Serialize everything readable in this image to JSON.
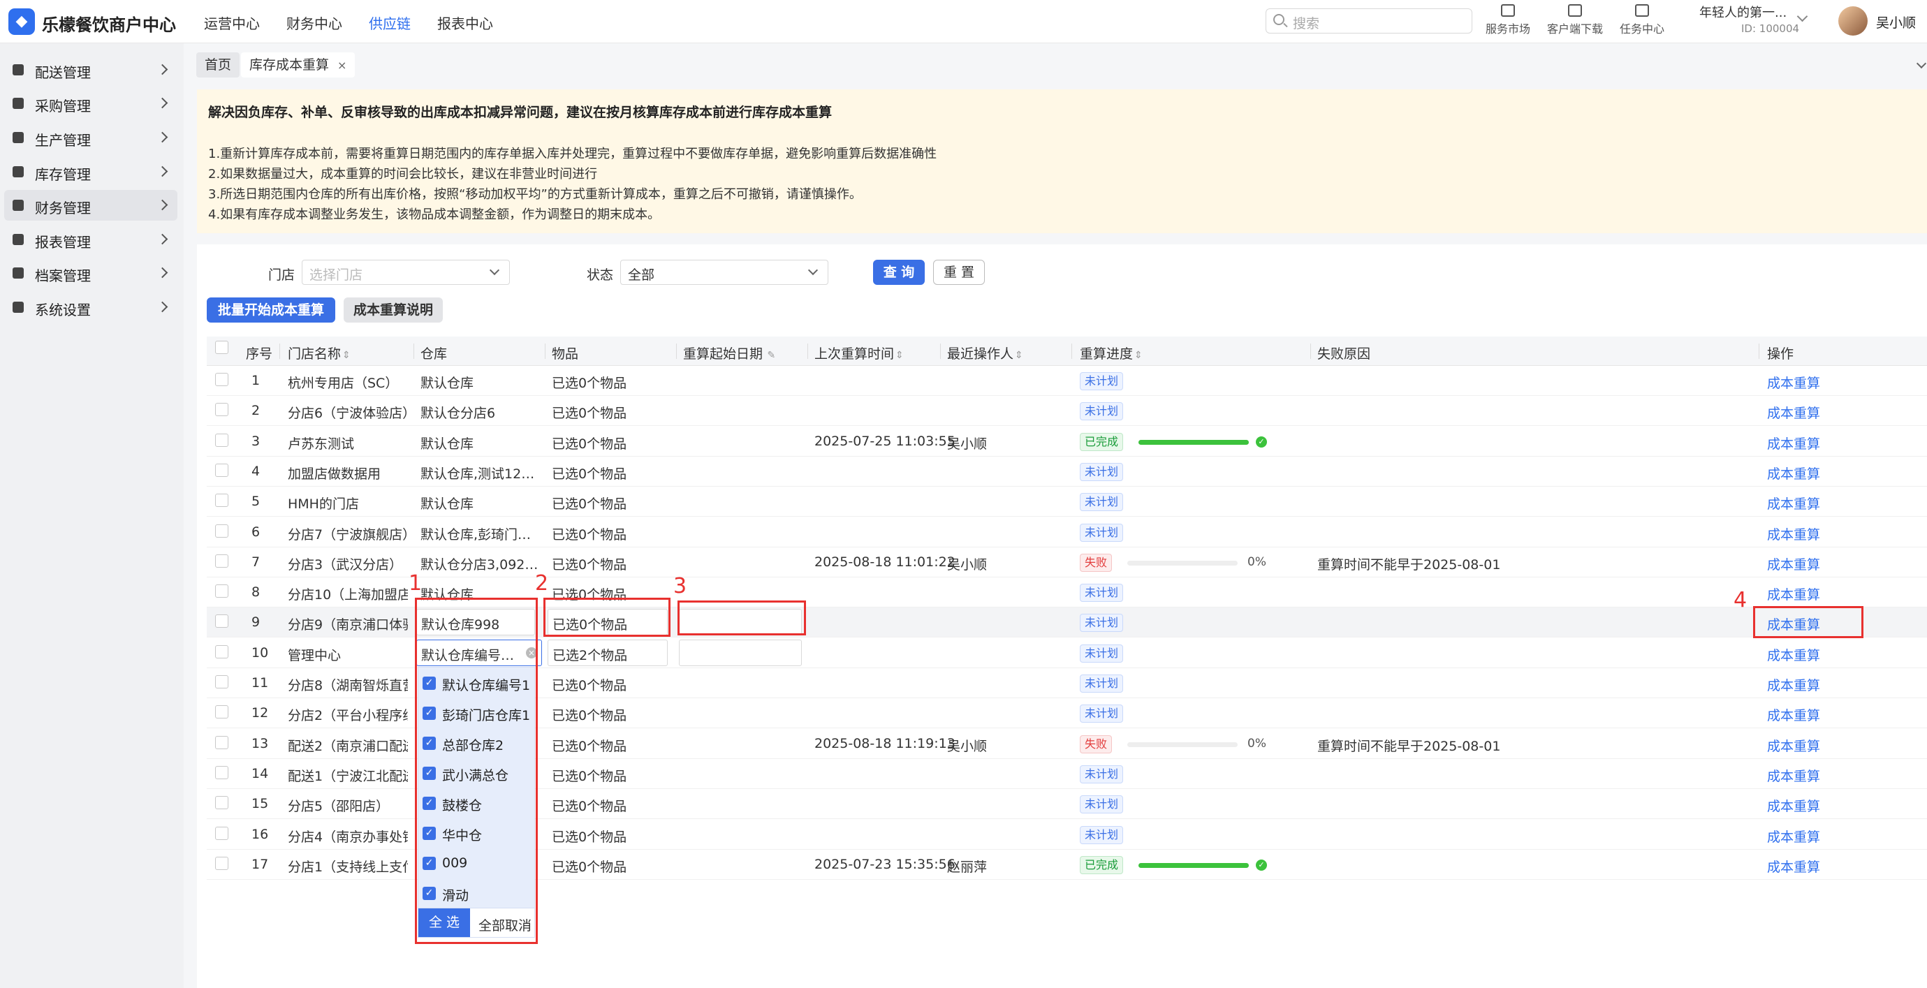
{
  "brand": {
    "name": "乐檬餐饮商户中心"
  },
  "topnav": [
    "运营中心",
    "财务中心",
    "供应链",
    "报表中心"
  ],
  "topnav_active": "供应链",
  "search": {
    "placeholder": "搜索"
  },
  "tools": [
    "服务市场",
    "客户端下载",
    "任务中心"
  ],
  "account": {
    "name": "年轻人的第一...",
    "id": "ID: 100004",
    "user": "吴小顺"
  },
  "sidebar": [
    {
      "label": "配送管理",
      "icon": "truck-icon"
    },
    {
      "label": "采购管理",
      "icon": "cart-icon"
    },
    {
      "label": "生产管理",
      "icon": "bar-chart-icon"
    },
    {
      "label": "库存管理",
      "icon": "warehouse-icon"
    },
    {
      "label": "财务管理",
      "icon": "finance-icon",
      "active": true
    },
    {
      "label": "报表管理",
      "icon": "report-icon"
    },
    {
      "label": "档案管理",
      "icon": "archive-icon"
    },
    {
      "label": "系统设置",
      "icon": "gear-icon"
    }
  ],
  "tabs": {
    "home": "首页",
    "current": "库存成本重算",
    "close": "×"
  },
  "notice": {
    "title": "解决因负库存、补单、反审核导致的出库成本扣减异常问题，建议在按月核算库存成本前进行库存成本重算",
    "lines": [
      "1.重新计算库存成本前，需要将重算日期范围内的库存单据入库并处理完，重算过程中不要做库存单据，避免影响重算后数据准确性",
      "2.如果数据量过大，成本重算的时间会比较长，建议在非营业时间进行",
      "3.所选日期范围内仓库的所有出库价格，按照“移动加权平均”的方式重新计算成本，重算之后不可撤销，请谨慎操作。",
      "4.如果有库存成本调整业务发生，该物品成本调整金额，作为调整日的期末成本。"
    ]
  },
  "filters": {
    "store_label": "门店",
    "store_placeholder": "选择门店",
    "status_label": "状态",
    "status_value": "全部",
    "query": "查 询",
    "reset": "重 置"
  },
  "actions": {
    "batch": "批量开始成本重算",
    "help": "成本重算说明"
  },
  "columns": [
    "序号",
    "门店名称",
    "仓库",
    "物品",
    "重算起始日期",
    "上次重算时间",
    "最近操作人",
    "重算进度",
    "失败原因",
    "操作"
  ],
  "rows": [
    {
      "no": "1",
      "store": "杭州专用店（SC）",
      "wh": "默认仓库",
      "item": "已选0个物品",
      "last": "",
      "op": "",
      "status": "未计划",
      "kind": "plan",
      "progress": 0,
      "pct": "",
      "reason": "",
      "action": "成本重算"
    },
    {
      "no": "2",
      "store": "分店6（宁波体验店）",
      "wh": "默认仓分店6",
      "item": "已选0个物品",
      "last": "",
      "op": "",
      "status": "未计划",
      "kind": "plan",
      "progress": 0,
      "pct": "",
      "reason": "",
      "action": "成本重算"
    },
    {
      "no": "3",
      "store": "卢苏东测试",
      "wh": "默认仓库",
      "item": "已选0个物品",
      "last": "2025-07-25 11:03:55",
      "op": "吴小顺",
      "status": "已完成",
      "kind": "ok",
      "progress": 100,
      "pct": "",
      "reason": "",
      "action": "成本重算"
    },
    {
      "no": "4",
      "store": "加盟店做数据用",
      "wh": "默认仓库,测试12…",
      "item": "已选0个物品",
      "last": "",
      "op": "",
      "status": "未计划",
      "kind": "plan",
      "progress": 0,
      "pct": "",
      "reason": "",
      "action": "成本重算"
    },
    {
      "no": "5",
      "store": "HMH的门店",
      "wh": "默认仓库",
      "item": "已选0个物品",
      "last": "",
      "op": "",
      "status": "未计划",
      "kind": "plan",
      "progress": 0,
      "pct": "",
      "reason": "",
      "action": "成本重算"
    },
    {
      "no": "6",
      "store": "分店7（宁波旗舰店）",
      "wh": "默认仓库,彭琦门…",
      "item": "已选0个物品",
      "last": "",
      "op": "",
      "status": "未计划",
      "kind": "plan",
      "progress": 0,
      "pct": "",
      "reason": "",
      "action": "成本重算"
    },
    {
      "no": "7",
      "store": "分店3（武汉分店）",
      "wh": "默认仓分店3,092…",
      "item": "已选0个物品",
      "last": "2025-08-18 11:01:22",
      "op": "吴小顺",
      "status": "失败",
      "kind": "fail",
      "progress": 0,
      "pct": "0%",
      "reason": "重算时间不能早于2025-08-01",
      "action": "成本重算"
    },
    {
      "no": "8",
      "store": "分店10（上海加盟店）",
      "wh": "默认仓库",
      "item": "已选0个物品",
      "last": "",
      "op": "",
      "status": "未计划",
      "kind": "plan",
      "progress": 0,
      "pct": "",
      "reason": "",
      "action": "成本重算"
    },
    {
      "no": "9",
      "store": "分店9（南京浦口体验",
      "wh": "默认仓库998",
      "item": "已选0个物品",
      "last": "",
      "op": "",
      "status": "未计划",
      "kind": "plan",
      "progress": 0,
      "pct": "",
      "reason": "",
      "action": "成本重算"
    },
    {
      "no": "10",
      "store": "管理中心",
      "wh": "默认仓库编号…",
      "item": "已选2个物品",
      "last": "",
      "op": "",
      "status": "未计划",
      "kind": "plan",
      "progress": 0,
      "pct": "",
      "reason": "",
      "action": "成本重算"
    },
    {
      "no": "11",
      "store": "分店8（湖南智烁直营",
      "wh": "",
      "item": "已选0个物品",
      "last": "",
      "op": "",
      "status": "未计划",
      "kind": "plan",
      "progress": 0,
      "pct": "",
      "reason": "",
      "action": "成本重算"
    },
    {
      "no": "12",
      "store": "分店2（平台小程序线",
      "wh": "",
      "item": "已选0个物品",
      "last": "",
      "op": "",
      "status": "未计划",
      "kind": "plan",
      "progress": 0,
      "pct": "",
      "reason": "",
      "action": "成本重算"
    },
    {
      "no": "13",
      "store": "配送2（南京浦口配送",
      "wh": "",
      "item": "已选0个物品",
      "last": "2025-08-18 11:19:13",
      "op": "吴小顺",
      "status": "失败",
      "kind": "fail",
      "progress": 0,
      "pct": "0%",
      "reason": "重算时间不能早于2025-08-01",
      "action": "成本重算"
    },
    {
      "no": "14",
      "store": "配送1（宁波江北配送",
      "wh": "",
      "item": "已选0个物品",
      "last": "",
      "op": "",
      "status": "未计划",
      "kind": "plan",
      "progress": 0,
      "pct": "",
      "reason": "",
      "action": "成本重算"
    },
    {
      "no": "15",
      "store": "分店5（邵阳店）",
      "wh": "",
      "item": "已选0个物品",
      "last": "",
      "op": "",
      "status": "未计划",
      "kind": "plan",
      "progress": 0,
      "pct": "",
      "reason": "",
      "action": "成本重算"
    },
    {
      "no": "16",
      "store": "分店4（南京办事处销",
      "wh": "",
      "item": "已选0个物品",
      "last": "",
      "op": "",
      "status": "未计划",
      "kind": "plan",
      "progress": 0,
      "pct": "",
      "reason": "",
      "action": "成本重算"
    },
    {
      "no": "17",
      "store": "分店1（支持线上支付",
      "wh": "",
      "item": "已选0个物品",
      "last": "2025-07-23 15:35:56",
      "op": "赵丽萍",
      "status": "已完成",
      "kind": "ok",
      "progress": 100,
      "pct": "",
      "reason": "",
      "action": "成本重算"
    }
  ],
  "dropdown": {
    "options": [
      "默认仓库编号1",
      "彭琦门店仓库1",
      "总部仓库2",
      "武小满总仓",
      "鼓楼仓",
      "华中仓",
      "009",
      "滑动"
    ],
    "select_all": "全 选",
    "clear_all": "全部取消"
  },
  "annotations": [
    "1",
    "2",
    "3",
    "4"
  ],
  "colors": {
    "accent": "#2f6fee",
    "annotation": "#e8312f",
    "success": "#3cc23c",
    "danger": "#e23c3c",
    "notice_bg": "#fff8e6"
  }
}
